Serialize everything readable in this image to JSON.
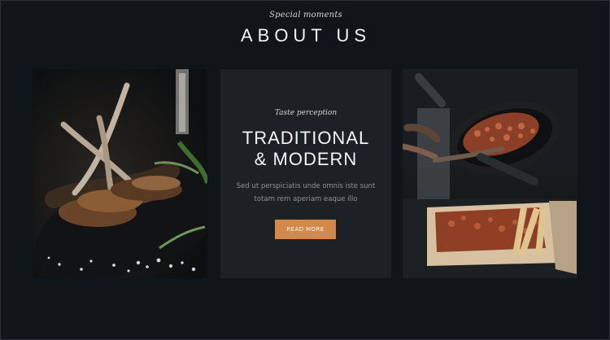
{
  "header": {
    "eyebrow": "Special moments",
    "title": "ABOUT US"
  },
  "feature": {
    "eyebrow": "Taste perception",
    "heading_line1": "TRADITIONAL",
    "heading_line2": "& MODERN",
    "body_line1": "Sed ut perspiciatis unde omnis iste sunt",
    "body_line2": "totam rem aperiam eaque illo",
    "button_label": "READ MORE"
  },
  "images": {
    "left": "lamb-chops-photo",
    "right": "pan-and-fries-photo"
  },
  "colors": {
    "background": "#0f1519",
    "panel": "#1b2125",
    "accent": "#d18a4b"
  }
}
